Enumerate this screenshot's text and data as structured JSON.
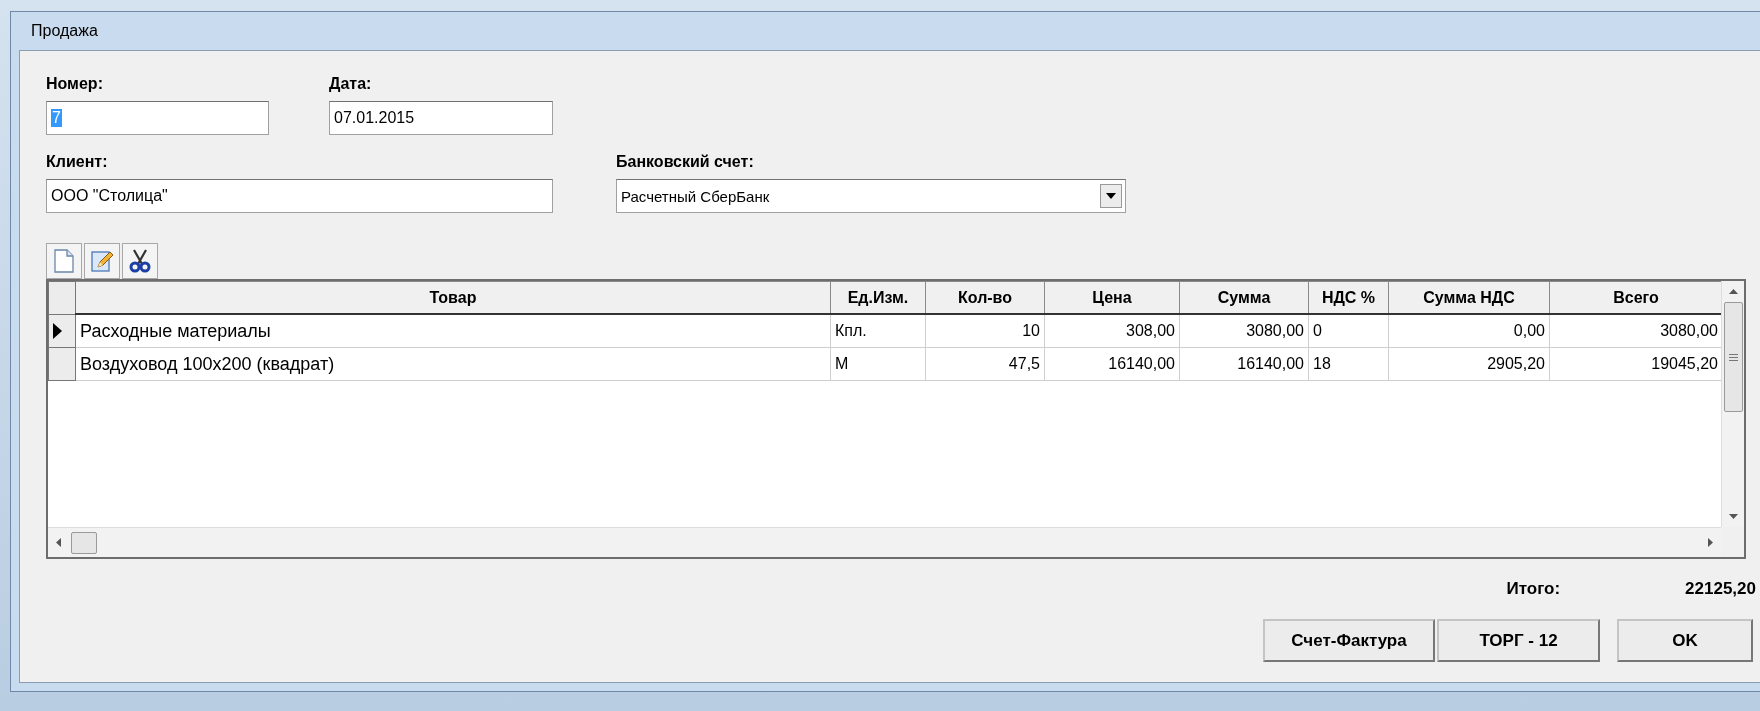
{
  "window": {
    "title": "Продажа"
  },
  "form": {
    "number": {
      "label": "Номер:",
      "value": "7",
      "value_selected": true
    },
    "date": {
      "label": "Дата:",
      "value": "07.01.2015"
    },
    "client": {
      "label": "Клиент:",
      "value": "ООО \"Столица\""
    },
    "bank_account": {
      "label": "Банковский счет:",
      "value": "Расчетный СберБанк"
    }
  },
  "table": {
    "columns": [
      {
        "label": "Товар",
        "kind": "text"
      },
      {
        "label": "Ед.Изм.",
        "kind": "text"
      },
      {
        "label": "Кол-во",
        "kind": "number"
      },
      {
        "label": "Цена",
        "kind": "number"
      },
      {
        "label": "Сумма",
        "kind": "number"
      },
      {
        "label": "НДС %",
        "kind": "text"
      },
      {
        "label": "Сумма НДС",
        "kind": "number"
      },
      {
        "label": "Всего",
        "kind": "number"
      }
    ],
    "rows": [
      {
        "selected": true,
        "cells": [
          "Расходные материалы",
          "Кпл.",
          "10",
          "308,00",
          "3080,00",
          "0",
          "0,00",
          "3080,00"
        ]
      },
      {
        "selected": false,
        "cells": [
          "Воздуховод 100x200 (квадрат)",
          "М",
          "47,5",
          "16140,00",
          "16140,00",
          "18",
          "2905,20",
          "19045,20"
        ]
      }
    ]
  },
  "total": {
    "label": "Итого:",
    "value": "22125,20"
  },
  "buttons": [
    "Счет-Фактура",
    "ТОРГ - 12",
    "OK"
  ]
}
